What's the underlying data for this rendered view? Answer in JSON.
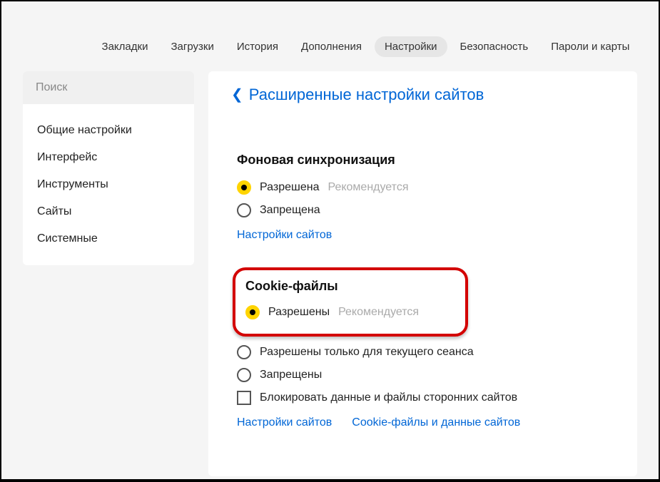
{
  "topnav": {
    "items": [
      {
        "label": "Закладки"
      },
      {
        "label": "Загрузки"
      },
      {
        "label": "История"
      },
      {
        "label": "Дополнения"
      },
      {
        "label": "Настройки",
        "active": true
      },
      {
        "label": "Безопасность"
      },
      {
        "label": "Пароли и карты"
      }
    ]
  },
  "sidebar": {
    "search_placeholder": "Поиск",
    "items": [
      {
        "label": "Общие настройки"
      },
      {
        "label": "Интерфейс"
      },
      {
        "label": "Инструменты"
      },
      {
        "label": "Сайты"
      },
      {
        "label": "Системные"
      }
    ]
  },
  "breadcrumb": {
    "title": "Расширенные настройки сайтов"
  },
  "bgsync": {
    "title": "Фоновая синхронизация",
    "allowed": "Разрешена",
    "hint": "Рекомендуется",
    "denied": "Запрещена",
    "link": "Настройки сайтов"
  },
  "cookies": {
    "title": "Cookie-файлы",
    "allowed": "Разрешены",
    "hint": "Рекомендуется",
    "session_only": "Разрешены только для текущего сеанса",
    "denied": "Запрещены",
    "block_third": "Блокировать данные и файлы сторонних сайтов",
    "link1": "Настройки сайтов",
    "link2": "Cookie-файлы и данные сайтов"
  }
}
